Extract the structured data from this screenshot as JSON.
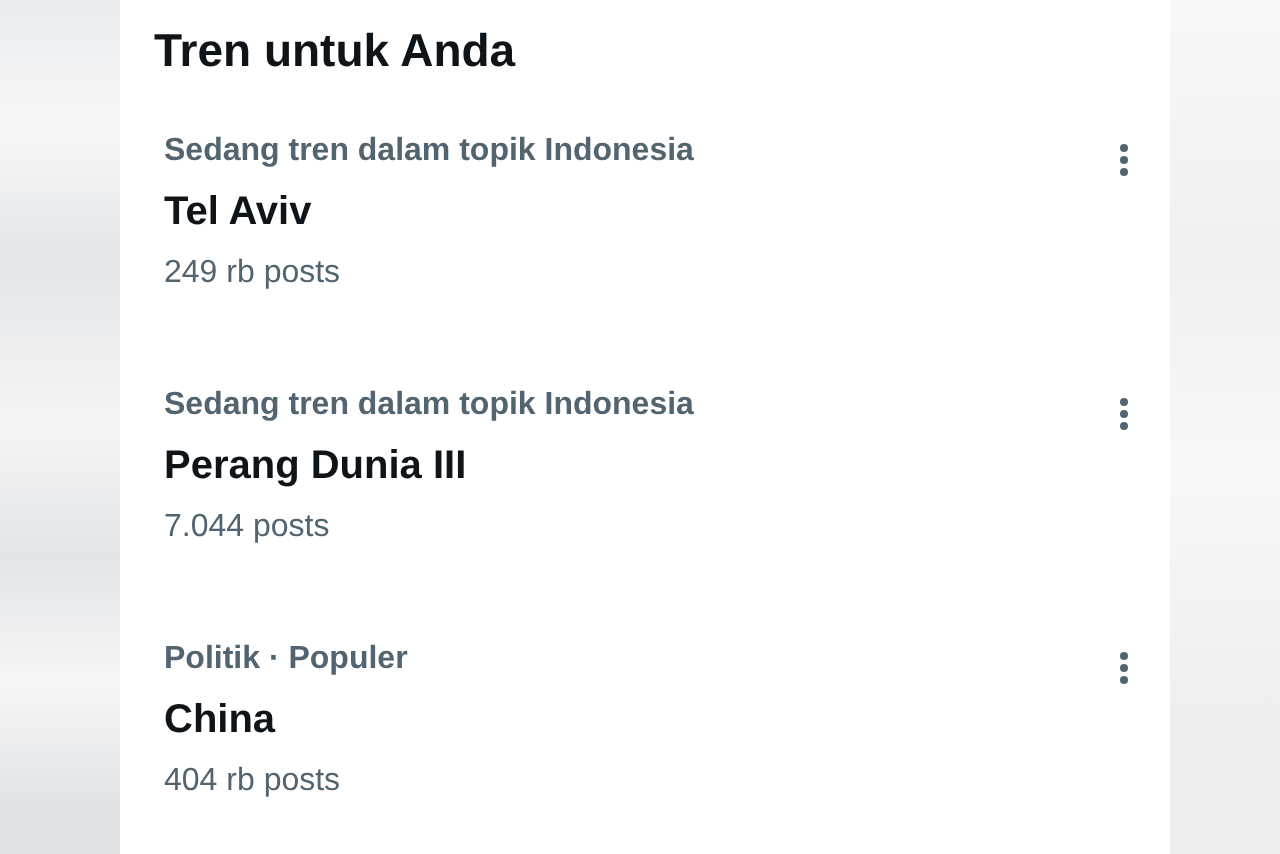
{
  "section_title": "Tren untuk Anda",
  "trends": [
    {
      "category": "Sedang tren dalam topik Indonesia",
      "topic": "Tel Aviv",
      "posts": "249 rb posts"
    },
    {
      "category": "Sedang tren dalam topik Indonesia",
      "topic": "Perang Dunia III",
      "posts": "7.044 posts"
    },
    {
      "category": "Politik · Populer",
      "topic": "China",
      "posts": "404 rb posts"
    }
  ]
}
